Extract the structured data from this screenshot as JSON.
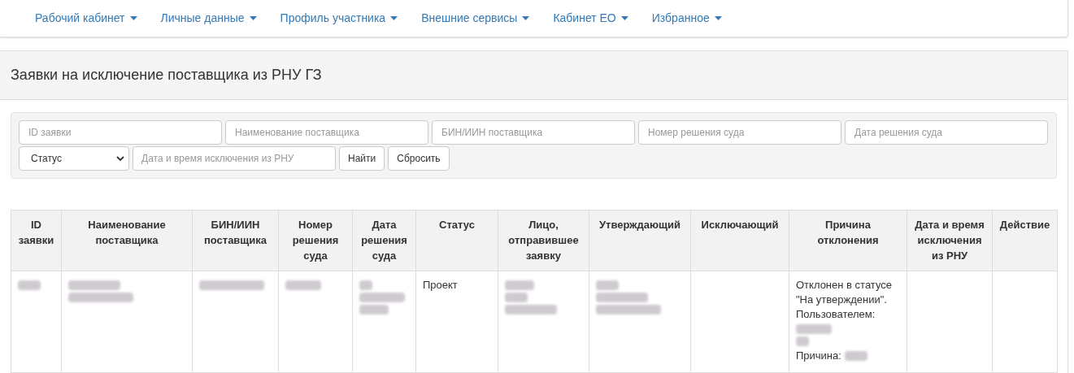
{
  "nav": [
    {
      "label": "Рабочий кабинет"
    },
    {
      "label": "Личные данные"
    },
    {
      "label": "Профиль участника"
    },
    {
      "label": "Внешние сервисы"
    },
    {
      "label": "Кабинет ЕО"
    },
    {
      "label": "Избранное"
    }
  ],
  "panel": {
    "title": "Заявки на исключение поставщика из РНУ ГЗ"
  },
  "filters": {
    "fields": [
      {
        "placeholder": "ID заявки"
      },
      {
        "placeholder": "Наименование поставщика"
      },
      {
        "placeholder": "БИН/ИИН поставщика"
      },
      {
        "placeholder": "Номер решения суда"
      },
      {
        "placeholder": "Дата решения суда"
      }
    ],
    "status_select": {
      "value": "Статус"
    },
    "date_field": {
      "placeholder": "Дата и время исключения из РНУ"
    },
    "buttons": [
      "Найти",
      "Сбросить"
    ]
  },
  "table": {
    "columns": [
      "ID заявки",
      "Наименование поставщика",
      "БИН/ИИН поставщика",
      "Номер решения суда",
      "Дата решения суда",
      "Статус",
      "Лицо, отправившее заявку",
      "Утверждающий",
      "Исключающий",
      "Причина отклонения",
      "Дата и время исключения из РНУ",
      "Действие"
    ],
    "rows": [
      {
        "cells": [
          [
            {
              "kind": "redacted"
            }
          ],
          [
            {
              "kind": "redacted"
            },
            {
              "kind": "redacted"
            }
          ],
          [
            {
              "kind": "redacted"
            }
          ],
          [
            {
              "kind": "redacted"
            }
          ],
          [
            {
              "kind": "redacted"
            },
            {
              "kind": "redacted"
            },
            {
              "kind": "redacted"
            }
          ],
          [
            {
              "kind": "text",
              "text": "Проект"
            }
          ],
          [
            {
              "kind": "redacted"
            },
            {
              "kind": "redacted"
            },
            {
              "kind": "redacted"
            }
          ],
          [
            {
              "kind": "redacted"
            },
            {
              "kind": "redacted"
            },
            {
              "kind": "redacted"
            }
          ],
          [],
          [
            {
              "kind": "text",
              "text": "Отклонен в статусе \"На утверждении\". Пользователем:"
            },
            {
              "kind": "redacted"
            },
            {
              "kind": "redacted"
            },
            {
              "kind": "text_redacted",
              "text": "Причина:"
            }
          ],
          [],
          []
        ]
      }
    ]
  }
}
